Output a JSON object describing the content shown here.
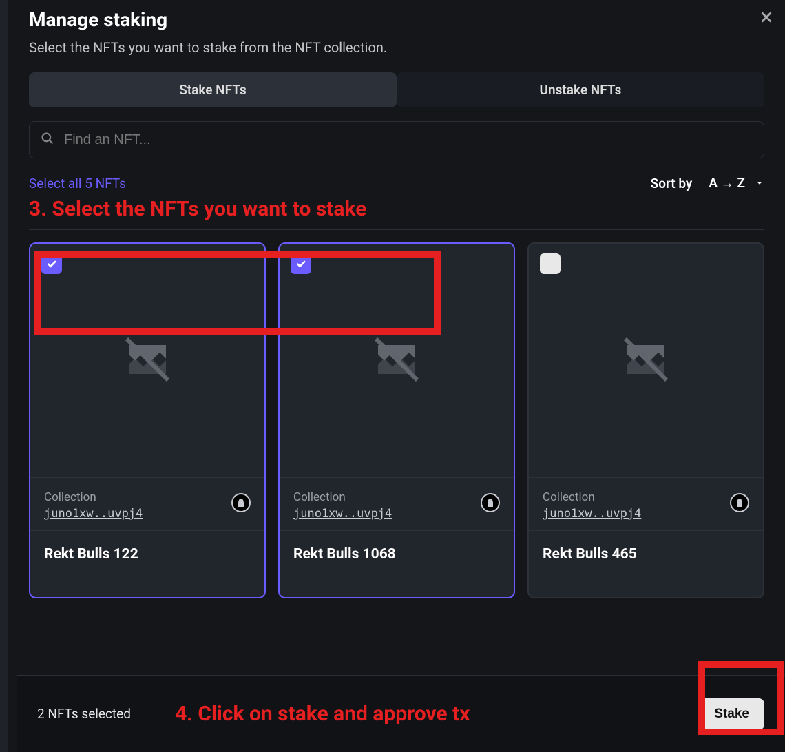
{
  "modal": {
    "title": "Manage staking",
    "subtitle": "Select the NFTs you want to stake from the NFT collection."
  },
  "tabs": {
    "stake": "Stake NFTs",
    "unstake": "Unstake NFTs"
  },
  "search": {
    "placeholder": "Find an NFT..."
  },
  "controls": {
    "select_all": "Select all 5 NFTs",
    "sort_label": "Sort by",
    "sort_value": "A → Z"
  },
  "annotations": {
    "step3": "3. Select the NFTs you want to stake",
    "step4": "4. Click on stake and approve tx"
  },
  "cards": [
    {
      "selected": true,
      "collection_label": "Collection",
      "address": "juno1xw..uvpj4",
      "name": "Rekt Bulls 122"
    },
    {
      "selected": true,
      "collection_label": "Collection",
      "address": "juno1xw..uvpj4",
      "name": "Rekt Bulls 1068"
    },
    {
      "selected": false,
      "collection_label": "Collection",
      "address": "juno1xw..uvpj4",
      "name": "Rekt Bulls 465"
    }
  ],
  "footer": {
    "selected_text": "2 NFTs selected",
    "stake_button": "Stake"
  }
}
